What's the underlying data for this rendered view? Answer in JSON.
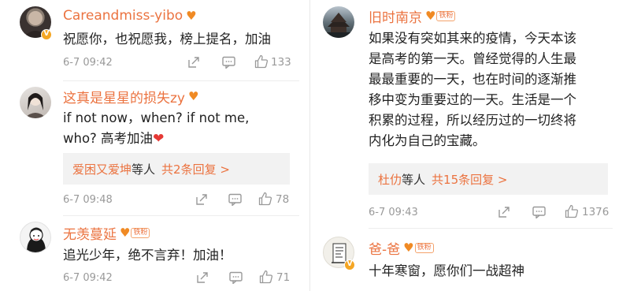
{
  "comments": [
    {
      "name": "Careandmiss-yibo",
      "fan_label": "",
      "text_lines": [
        "祝愿你，也祝愿我，榜上提名，加油"
      ],
      "time": "6-7 09:42",
      "likes": "133"
    },
    {
      "name": "这真是星星的损失zy",
      "fan_label": "",
      "text_lines": [
        "if not now，when? if not me,",
        "who? 高考加油"
      ],
      "reply": {
        "names": "爱困又爱坤",
        "mid": "等人",
        "count": "共2条回复 >"
      },
      "time": "6-7 09:48",
      "likes": "78"
    },
    {
      "name": "无羡蔓延",
      "fan_label": "铁粉",
      "text_lines": [
        "追光少年，绝不言弃！加油！"
      ],
      "time": "6-7 09:42",
      "likes": "71"
    },
    {
      "name": "旧时南京",
      "fan_label": "铁粉",
      "text_lines": [
        "如果没有突如其来的疫情，今天本该",
        "是高考的第一天。曾经觉得的人生最",
        "最最重要的一天，也在时间的逐渐推",
        "移中变为重要过的一天。生活是一个",
        "积累的过程，所以经历过的一切终将",
        "内化为自己的宝藏。"
      ],
      "reply": {
        "names": "杜仂",
        "mid": "等人",
        "count": "共15条回复 >"
      },
      "time": "6-7 09:43",
      "likes": "1376"
    },
    {
      "name": "爸-爸",
      "fan_label": "铁粉",
      "text_lines": [
        "十年寒窗，愿你们一战超神"
      ]
    }
  ],
  "colors": {
    "name": "#eb7340",
    "heart": "#e53935",
    "meta": "#999999"
  }
}
